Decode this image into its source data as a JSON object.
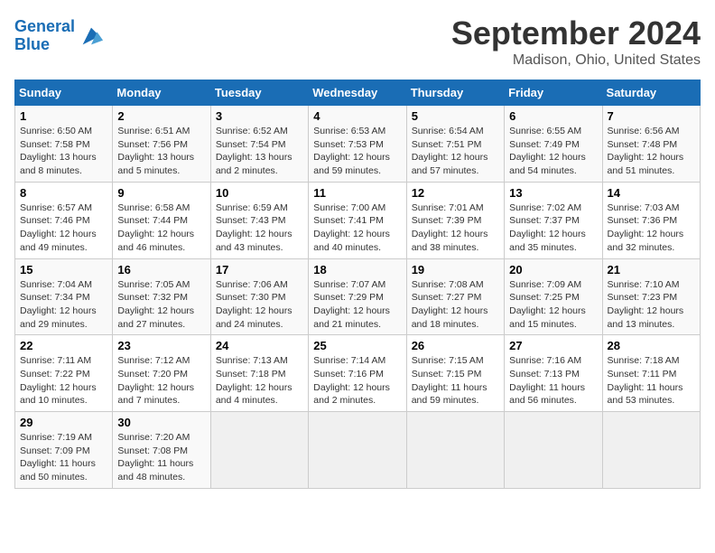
{
  "header": {
    "logo_line1": "General",
    "logo_line2": "Blue",
    "title": "September 2024",
    "subtitle": "Madison, Ohio, United States"
  },
  "days": [
    "Sunday",
    "Monday",
    "Tuesday",
    "Wednesday",
    "Thursday",
    "Friday",
    "Saturday"
  ],
  "weeks": [
    [
      {
        "date": "1",
        "info": "Sunrise: 6:50 AM\nSunset: 7:58 PM\nDaylight: 13 hours\nand 8 minutes."
      },
      {
        "date": "2",
        "info": "Sunrise: 6:51 AM\nSunset: 7:56 PM\nDaylight: 13 hours\nand 5 minutes."
      },
      {
        "date": "3",
        "info": "Sunrise: 6:52 AM\nSunset: 7:54 PM\nDaylight: 13 hours\nand 2 minutes."
      },
      {
        "date": "4",
        "info": "Sunrise: 6:53 AM\nSunset: 7:53 PM\nDaylight: 12 hours\nand 59 minutes."
      },
      {
        "date": "5",
        "info": "Sunrise: 6:54 AM\nSunset: 7:51 PM\nDaylight: 12 hours\nand 57 minutes."
      },
      {
        "date": "6",
        "info": "Sunrise: 6:55 AM\nSunset: 7:49 PM\nDaylight: 12 hours\nand 54 minutes."
      },
      {
        "date": "7",
        "info": "Sunrise: 6:56 AM\nSunset: 7:48 PM\nDaylight: 12 hours\nand 51 minutes."
      }
    ],
    [
      {
        "date": "8",
        "info": "Sunrise: 6:57 AM\nSunset: 7:46 PM\nDaylight: 12 hours\nand 49 minutes."
      },
      {
        "date": "9",
        "info": "Sunrise: 6:58 AM\nSunset: 7:44 PM\nDaylight: 12 hours\nand 46 minutes."
      },
      {
        "date": "10",
        "info": "Sunrise: 6:59 AM\nSunset: 7:43 PM\nDaylight: 12 hours\nand 43 minutes."
      },
      {
        "date": "11",
        "info": "Sunrise: 7:00 AM\nSunset: 7:41 PM\nDaylight: 12 hours\nand 40 minutes."
      },
      {
        "date": "12",
        "info": "Sunrise: 7:01 AM\nSunset: 7:39 PM\nDaylight: 12 hours\nand 38 minutes."
      },
      {
        "date": "13",
        "info": "Sunrise: 7:02 AM\nSunset: 7:37 PM\nDaylight: 12 hours\nand 35 minutes."
      },
      {
        "date": "14",
        "info": "Sunrise: 7:03 AM\nSunset: 7:36 PM\nDaylight: 12 hours\nand 32 minutes."
      }
    ],
    [
      {
        "date": "15",
        "info": "Sunrise: 7:04 AM\nSunset: 7:34 PM\nDaylight: 12 hours\nand 29 minutes."
      },
      {
        "date": "16",
        "info": "Sunrise: 7:05 AM\nSunset: 7:32 PM\nDaylight: 12 hours\nand 27 minutes."
      },
      {
        "date": "17",
        "info": "Sunrise: 7:06 AM\nSunset: 7:30 PM\nDaylight: 12 hours\nand 24 minutes."
      },
      {
        "date": "18",
        "info": "Sunrise: 7:07 AM\nSunset: 7:29 PM\nDaylight: 12 hours\nand 21 minutes."
      },
      {
        "date": "19",
        "info": "Sunrise: 7:08 AM\nSunset: 7:27 PM\nDaylight: 12 hours\nand 18 minutes."
      },
      {
        "date": "20",
        "info": "Sunrise: 7:09 AM\nSunset: 7:25 PM\nDaylight: 12 hours\nand 15 minutes."
      },
      {
        "date": "21",
        "info": "Sunrise: 7:10 AM\nSunset: 7:23 PM\nDaylight: 12 hours\nand 13 minutes."
      }
    ],
    [
      {
        "date": "22",
        "info": "Sunrise: 7:11 AM\nSunset: 7:22 PM\nDaylight: 12 hours\nand 10 minutes."
      },
      {
        "date": "23",
        "info": "Sunrise: 7:12 AM\nSunset: 7:20 PM\nDaylight: 12 hours\nand 7 minutes."
      },
      {
        "date": "24",
        "info": "Sunrise: 7:13 AM\nSunset: 7:18 PM\nDaylight: 12 hours\nand 4 minutes."
      },
      {
        "date": "25",
        "info": "Sunrise: 7:14 AM\nSunset: 7:16 PM\nDaylight: 12 hours\nand 2 minutes."
      },
      {
        "date": "26",
        "info": "Sunrise: 7:15 AM\nSunset: 7:15 PM\nDaylight: 11 hours\nand 59 minutes."
      },
      {
        "date": "27",
        "info": "Sunrise: 7:16 AM\nSunset: 7:13 PM\nDaylight: 11 hours\nand 56 minutes."
      },
      {
        "date": "28",
        "info": "Sunrise: 7:18 AM\nSunset: 7:11 PM\nDaylight: 11 hours\nand 53 minutes."
      }
    ],
    [
      {
        "date": "29",
        "info": "Sunrise: 7:19 AM\nSunset: 7:09 PM\nDaylight: 11 hours\nand 50 minutes."
      },
      {
        "date": "30",
        "info": "Sunrise: 7:20 AM\nSunset: 7:08 PM\nDaylight: 11 hours\nand 48 minutes."
      },
      {
        "date": "",
        "info": ""
      },
      {
        "date": "",
        "info": ""
      },
      {
        "date": "",
        "info": ""
      },
      {
        "date": "",
        "info": ""
      },
      {
        "date": "",
        "info": ""
      }
    ]
  ]
}
